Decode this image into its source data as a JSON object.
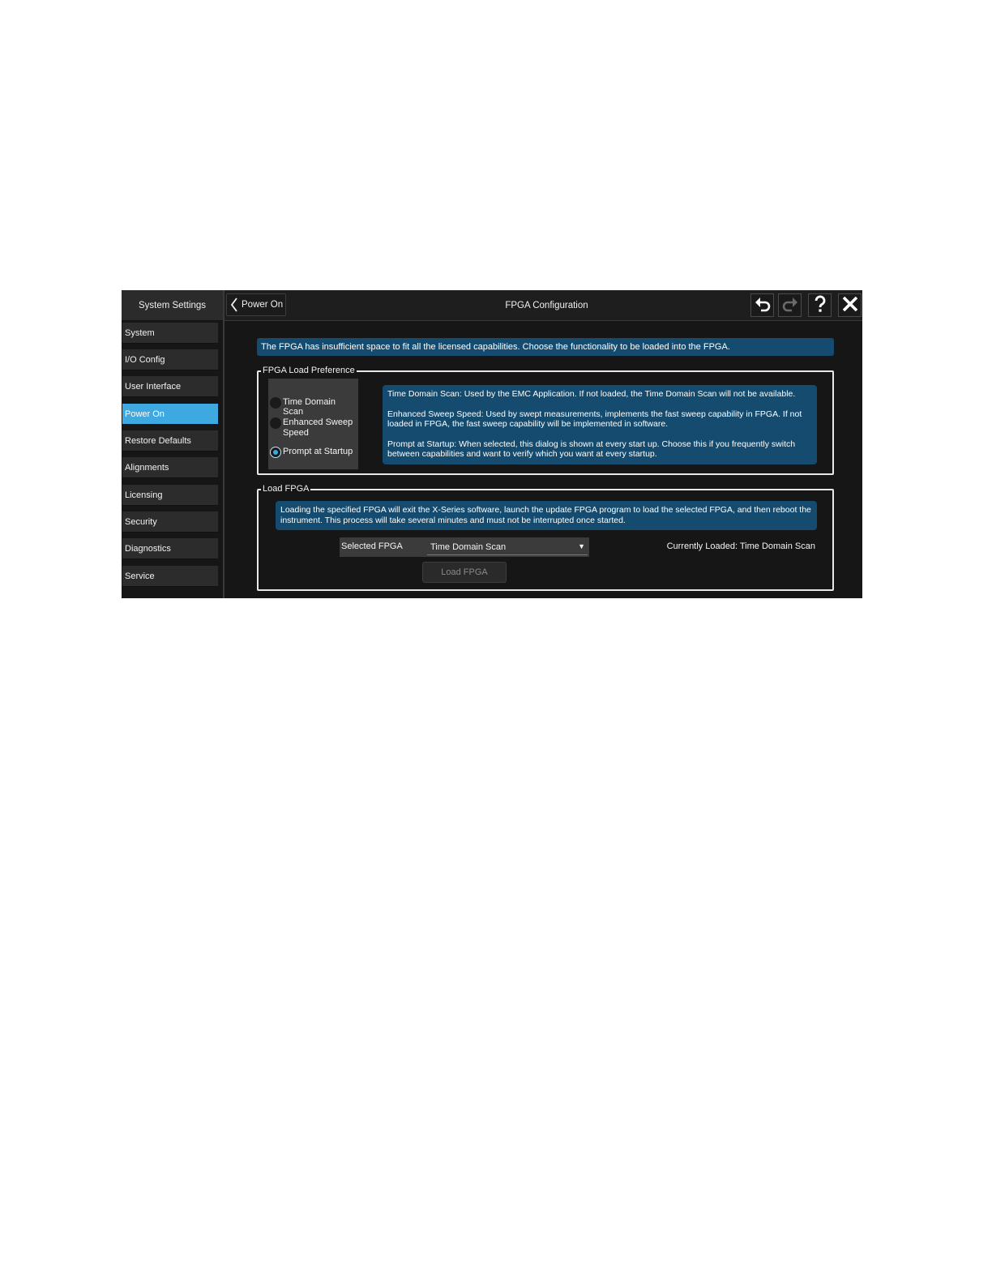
{
  "sidebar": {
    "title": "System Settings",
    "items": [
      {
        "label": "System"
      },
      {
        "label": "I/O Config"
      },
      {
        "label": "User Interface"
      },
      {
        "label": "Power On",
        "active": true
      },
      {
        "label": "Restore Defaults"
      },
      {
        "label": "Alignments"
      },
      {
        "label": "Licensing"
      },
      {
        "label": "Security"
      },
      {
        "label": "Diagnostics"
      },
      {
        "label": "Service"
      }
    ]
  },
  "header": {
    "back_label": "Power On",
    "title": "FPGA Configuration",
    "icons": [
      "undo-icon",
      "redo-icon",
      "help-icon",
      "close-icon"
    ]
  },
  "banner": "The FPGA has insufficient space to fit all the licensed capabilities. Choose the functionality to be loaded into the FPGA.",
  "load_preference": {
    "legend": "FPGA Load Preference",
    "options": [
      {
        "label": "Time Domain Scan",
        "checked": false
      },
      {
        "label": "Enhanced Sweep Speed",
        "checked": false
      },
      {
        "label": "Prompt at Startup",
        "checked": true
      }
    ],
    "descriptions": [
      "Time Domain Scan: Used by the EMC Application. If not loaded, the Time Domain Scan will not be available.",
      "Enhanced Sweep Speed: Used by swept measurements, implements the fast sweep capability in FPGA. If not loaded in FPGA, the fast sweep capability will be implemented in software.",
      "Prompt at Startup: When selected, this dialog is shown at every start up. Choose this if you frequently switch between capabilities and want to verify which you want at every startup."
    ]
  },
  "load_fpga": {
    "legend": "Load FPGA",
    "description": "Loading the specified FPGA will exit the X-Series software, launch the update FPGA program to load the selected FPGA, and then reboot the instrument. This process will take several minutes and must not be interrupted once started.",
    "select_label": "Selected FPGA",
    "select_value": "Time Domain Scan",
    "currently_loaded": "Currently Loaded: Time Domain Scan",
    "button_label": "Load FPGA"
  },
  "colors": {
    "accent": "#3ea9e0",
    "info_panel": "#154b6e",
    "background": "#161616"
  }
}
